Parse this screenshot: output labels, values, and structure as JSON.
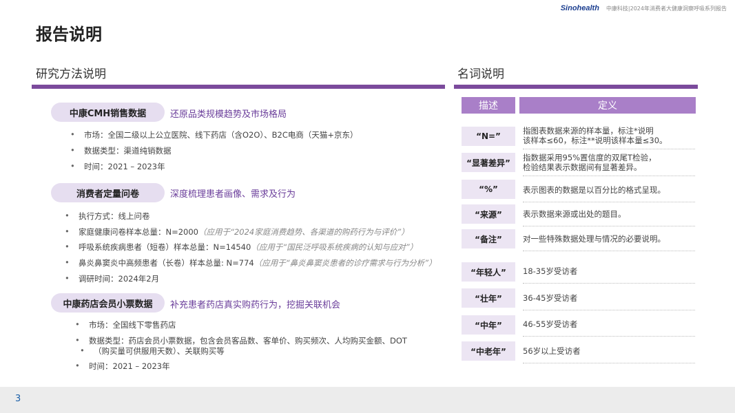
{
  "header": {
    "logo": "Sinohealth",
    "subtitle": "中康科技|2024年消费者大健康洞察呼吸系列报告"
  },
  "title": "报告说明",
  "left": {
    "heading": "研究方法说明",
    "groups": [
      {
        "pill": "中康CMH销售数据",
        "desc": "还原品类规模趋势及市场格局",
        "items": [
          {
            "text": "市场：全国二级以上公立医院、线下药店（含O2O）、B2C电商（天猫+京东）"
          },
          {
            "text": "数据类型：渠道纯销数据"
          },
          {
            "text": "时间：2021 – 2023年"
          }
        ]
      },
      {
        "pill": "消费者定量问卷",
        "desc": "深度梳理患者画像、需求及行为",
        "items": [
          {
            "text": "执行方式：线上问卷",
            "note": ""
          },
          {
            "text": "家庭健康问卷样本总量：N=2000",
            "note": "（应用于“2024家庭消费趋势、各渠道的购药行为与评价”）"
          },
          {
            "text": "呼吸系统疾病患者（短卷）样本总量：N=14540",
            "note": "（应用于“国民泛呼吸系统疾病的认知与应对”）"
          },
          {
            "text": "鼻炎鼻窦炎中高频患者（长卷）样本总量: N=774",
            "note": "（应用于“鼻炎鼻窦炎患者的诊疗需求与行为分析”）"
          },
          {
            "text": "调研时间：2024年2月",
            "note": ""
          }
        ]
      },
      {
        "pill": "中康药店会员小票数据",
        "desc": "补充患者药店真实购药行为，挖掘关联机会",
        "items": [
          {
            "text": "市场：全国线下零售药店"
          },
          {
            "text": "数据类型：药店会员小票数据，包含会员客品数、客单价、购买频次、人均购买金额、DOT",
            "text2": "（购买量可供服用天数）、关联购买等"
          },
          {
            "text": "时间：2021 – 2023年"
          }
        ]
      }
    ]
  },
  "right": {
    "heading": "名词说明",
    "col1": "描述",
    "col2": "定义",
    "rows": [
      {
        "term": "“N=”",
        "def": "指图表数据来源的样本量，标注*说明",
        "def2": "该样本≤60，标注**说明该样本量≤30。"
      },
      {
        "term": "“显著差异”",
        "def": "指数据采用95%置信度的双尾T检验，",
        "def2": "检验结果表示数据间有显著差异。"
      },
      {
        "term": "“%”",
        "def": "表示图表的数据是以百分比的格式呈现。"
      },
      {
        "term": "“来源”",
        "def": "表示数据来源或出处的题目。"
      },
      {
        "term": "“备注”",
        "def": "对一些特殊数据处理与情况的必要说明。"
      },
      {
        "term": "“年轻人”",
        "def": "18-35岁受访者"
      },
      {
        "term": "“壮年”",
        "def": "36-45岁受访者"
      },
      {
        "term": "“中年”",
        "def": "46-55岁受访者"
      },
      {
        "term": "“中老年”",
        "def": "56岁以上受访者"
      }
    ]
  },
  "page": "3"
}
